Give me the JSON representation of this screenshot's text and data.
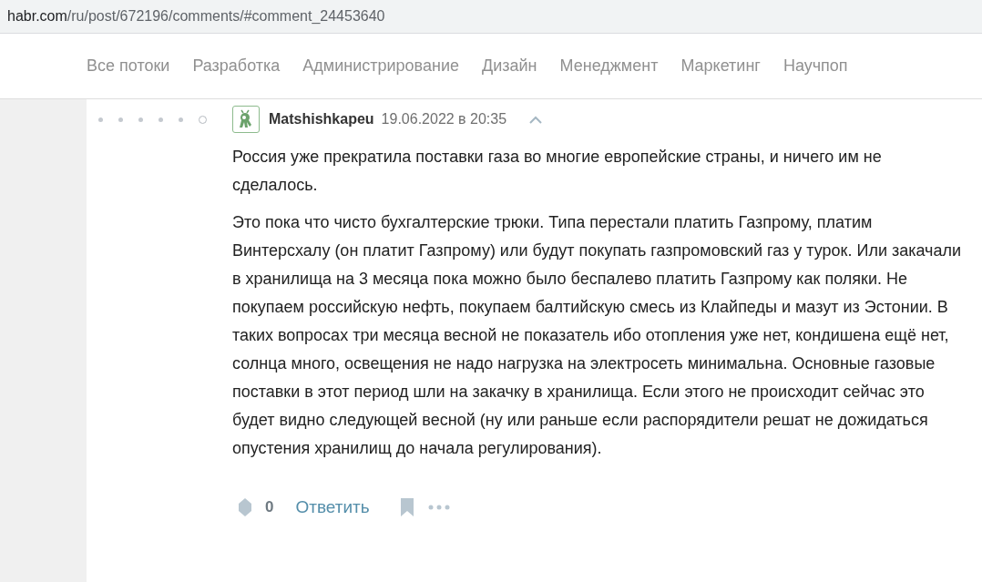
{
  "address_bar": {
    "host": "habr.com",
    "path": "/ru/post/672196/comments/#comment_24453640"
  },
  "nav": [
    {
      "label": "Все потоки"
    },
    {
      "label": "Разработка"
    },
    {
      "label": "Администрирование"
    },
    {
      "label": "Дизайн"
    },
    {
      "label": "Менеджмент"
    },
    {
      "label": "Маркетинг"
    },
    {
      "label": "Научпоп"
    }
  ],
  "comment": {
    "thread_markers": [
      {
        "kind": "dot"
      },
      {
        "kind": "dot"
      },
      {
        "kind": "dot"
      },
      {
        "kind": "dot"
      },
      {
        "kind": "dot"
      },
      {
        "kind": "ring"
      }
    ],
    "author": "Matshishkapeu",
    "date": "19.06.2022 в 20:35",
    "paragraphs": [
      "Россия уже прекратила поставки газа во многие европейские страны, и ничего им не сделалось.",
      "Это пока что чисто бухгалтерские трюки. Типа перестали платить Газпрому, платим Винтерсхалу (он платит Газпрому) или будут покупать газпромовский газ у турок. Или закачали в хранилища на 3 месяца пока можно было беспалево платить Газпрому как поляки. Не покупаем российскую нефть, покупаем балтийскую смесь из Клайпеды и мазут из Эстонии. В таких вопросах три месяца весной не показатель ибо отопления уже нет, кондишена ещё нет, солнца много, освещения не надо нагрузка на электросеть минимальна. Основные газовые поставки в этот период шли на закачку в хранилища. Если этого не происходит сейчас это будет видно следующей весной (ну или раньше если распорядители решат не дожидаться опустения хранилищ до начала регулирования)."
    ],
    "votes": "0",
    "reply": "Ответить"
  }
}
